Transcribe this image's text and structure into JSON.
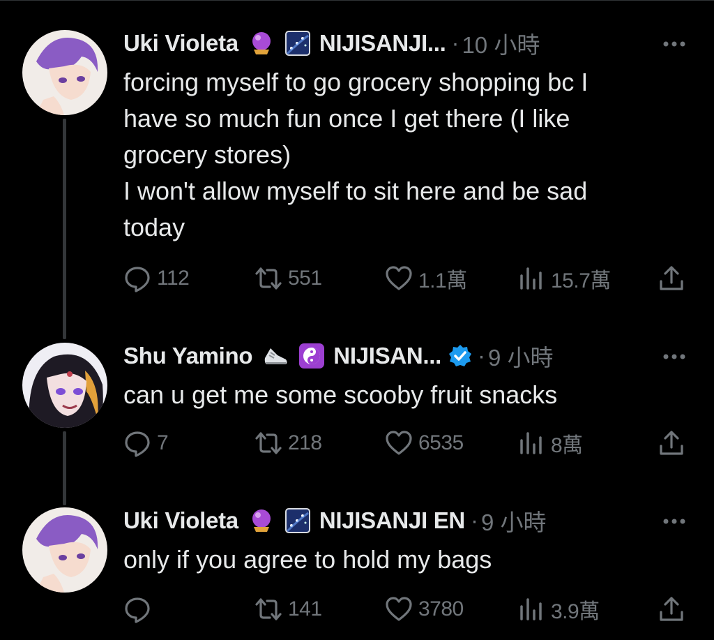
{
  "tweets": [
    {
      "author": "Uki Violeta",
      "emojis": [
        "crystal-ball-icon",
        "night-sky-icon"
      ],
      "handle": "NIJISANJI...",
      "verified": false,
      "dot": "·",
      "time": "10 小時",
      "text": "forcing myself to go grocery shopping bc I\nhave so much fun once I get there (I like\ngrocery stores)\nI won't allow myself to sit here and be sad\ntoday",
      "replies": "112",
      "retweets": "551",
      "likes": "1.1萬",
      "views": "15.7萬"
    },
    {
      "author": "Shu Yamino",
      "emojis": [
        "sneaker-icon",
        "yin-yang-icon"
      ],
      "handle": "NIJISAN...",
      "verified": true,
      "dot": "·",
      "time": "9 小時",
      "text": "can u get me some scooby fruit snacks",
      "replies": "7",
      "retweets": "218",
      "likes": "6535",
      "views": "8萬"
    },
    {
      "author": "Uki Violeta",
      "emojis": [
        "crystal-ball-icon",
        "night-sky-icon"
      ],
      "handle": "NIJISANJI EN",
      "verified": false,
      "dot": "·",
      "time": "9 小時",
      "text": "only if you agree to hold my bags",
      "replies": "",
      "retweets": "141",
      "likes": "3780",
      "views": "3.9萬"
    }
  ],
  "colors": {
    "background": "#000000",
    "text_primary": "#e7e9ea",
    "text_secondary": "#71767b",
    "verified_blue": "#1d9bf0",
    "thread_line": "#333639"
  }
}
